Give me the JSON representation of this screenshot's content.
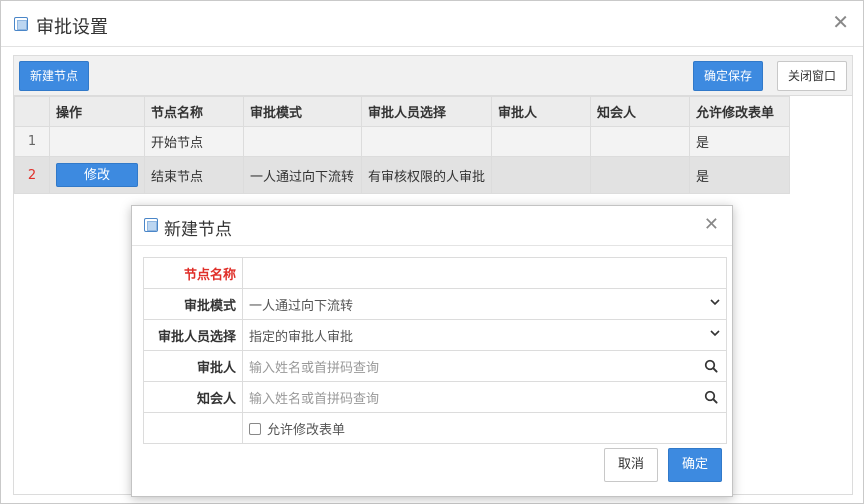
{
  "window": {
    "title": "审批设置",
    "close_glyph": "✕"
  },
  "toolbar": {
    "new_node": "新建节点",
    "confirm_save": "确定保存",
    "close_window": "关闭窗口"
  },
  "table": {
    "headers": [
      "操作",
      "节点名称",
      "审批模式",
      "审批人员选择",
      "审批人",
      "知会人",
      "允许修改表单"
    ],
    "rows": [
      {
        "index": "1",
        "action": "",
        "name": "开始节点",
        "mode": "",
        "selection": "",
        "approver": "",
        "notify": "",
        "allow_edit": "是"
      },
      {
        "index": "2",
        "action": "修改",
        "name": "结束节点",
        "mode": "一人通过向下流转",
        "selection": "有审核权限的人审批",
        "approver": "",
        "notify": "",
        "allow_edit": "是"
      }
    ]
  },
  "modal": {
    "title": "新建节点",
    "close_glyph": "✕",
    "fields": {
      "node_name_label": "节点名称",
      "node_name_value": "",
      "mode_label": "审批模式",
      "mode_value": "一人通过向下流转",
      "selection_label": "审批人员选择",
      "selection_value": "指定的审批人审批",
      "approver_label": "审批人",
      "approver_placeholder": "输入姓名或首拼码查询",
      "notify_label": "知会人",
      "notify_placeholder": "输入姓名或首拼码查询",
      "allow_edit_label": "允许修改表单"
    },
    "cancel": "取消",
    "ok": "确定"
  },
  "colors": {
    "primary": "#3d8ae0",
    "required": "#e0302a"
  }
}
